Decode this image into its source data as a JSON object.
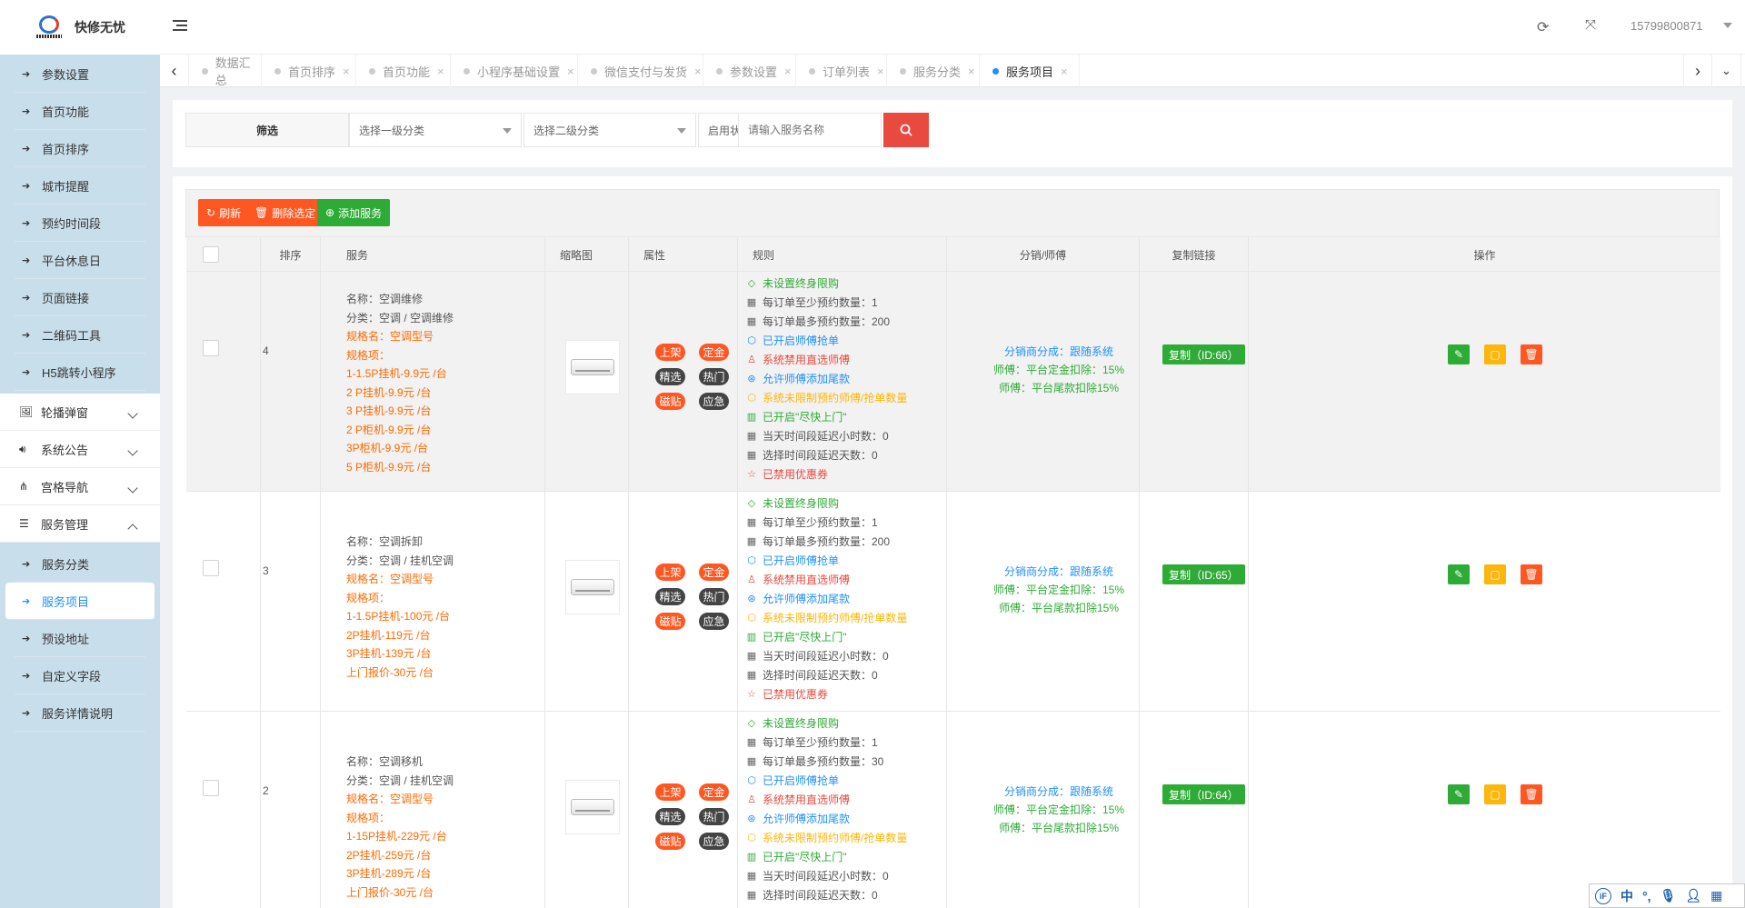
{
  "app": {
    "name": "快修无忧"
  },
  "sidebar": {
    "items": [
      {
        "label": "参数设置"
      },
      {
        "label": "首页功能"
      },
      {
        "label": "首页排序"
      },
      {
        "label": "城市提醒"
      },
      {
        "label": "预约时间段"
      },
      {
        "label": "平台休息日"
      },
      {
        "label": "页面链接"
      },
      {
        "label": "二维码工具"
      },
      {
        "label": "H5跳转小程序"
      }
    ],
    "groups": [
      {
        "label": "轮播弹窗",
        "icon": "image-icon"
      },
      {
        "label": "系统公告",
        "icon": "speaker-icon"
      },
      {
        "label": "宫格导航",
        "icon": "sitemap-icon"
      },
      {
        "label": "服务管理",
        "icon": "server-icon"
      }
    ],
    "sub_items": [
      {
        "label": "服务分类"
      },
      {
        "label": "服务项目"
      },
      {
        "label": "预设地址"
      },
      {
        "label": "自定义字段"
      },
      {
        "label": "服务详情说明"
      }
    ]
  },
  "topbar": {
    "user": "15799800871"
  },
  "tabs": [
    {
      "label": "数据汇总"
    },
    {
      "label": "首页排序"
    },
    {
      "label": "首页功能"
    },
    {
      "label": "小程序基础设置"
    },
    {
      "label": "微信支付与发货"
    },
    {
      "label": "参数设置"
    },
    {
      "label": "订单列表"
    },
    {
      "label": "服务分类"
    },
    {
      "label": "服务项目"
    }
  ],
  "filter": {
    "label": "筛选",
    "select1": "选择一级分类",
    "select2": "选择二级分类",
    "select3": "启用状态",
    "search_placeholder": "请输入服务名称"
  },
  "actions": {
    "refresh": "刷新",
    "delete_selected": "删除选定",
    "add_service": "添加服务"
  },
  "columns": [
    "排序",
    "服务",
    "缩略图",
    "属性",
    "规则",
    "分销/师傅",
    "复制链接",
    "操作"
  ],
  "colors": {
    "orange": "#ff5722",
    "green": "#2eab36",
    "blue": "#1e90ff",
    "red": "#e84a3f",
    "yellow": "#fdb60b"
  },
  "rows": [
    {
      "sort": "4",
      "name": "名称：空调维修",
      "category": "分类：空调 / 空调维修",
      "spec_name": "规格名：空调型号",
      "spec_title": "规格项：",
      "specs": [
        "1-1.5P挂机-9.9元 /台",
        "2 P挂机-9.9元 /台",
        " 3 P挂机-9.9元 /台",
        "2 P柜机-9.9元 /台",
        "3P柜机-9.9元 /台",
        " 5 P柜机-9.9元 /台"
      ],
      "tags": [
        "上架",
        "定金",
        "精选",
        "热门",
        "磁贴",
        "应急"
      ],
      "rules": [
        "未设置终身限购",
        "每订单至少预约数量：1",
        "每订单最多预约数量：200",
        "已开启师傅抢单",
        "系统禁用直选师傅",
        "允许师傅添加尾款",
        "系统未限制预约师傅/抢单数量",
        "已开启\"尽快上门\"",
        "当天时间段延迟小时数：0",
        "选择时间段延迟天数：0",
        "已禁用优惠券"
      ],
      "dist": [
        "分销商分成：跟随系统",
        "师傅：平台定金扣除：15%",
        "师傅：平台尾款扣除15%"
      ],
      "copy": "复制（ID:66）"
    },
    {
      "sort": "3",
      "name": "名称：空调拆卸",
      "category": "分类：空调 / 挂机空调",
      "spec_name": "规格名：空调型号",
      "spec_title": "规格项：",
      "specs": [
        "1-1.5P挂机-100元 /台",
        "2P挂机-119元 /台",
        "3P挂机-139元 /台",
        "上门报价-30元 /台"
      ],
      "tags": [
        "上架",
        "定金",
        "精选",
        "热门",
        "磁贴",
        "应急"
      ],
      "rules": [
        "未设置终身限购",
        "每订单至少预约数量：1",
        "每订单最多预约数量：200",
        "已开启师傅抢单",
        "系统禁用直选师傅",
        "允许师傅添加尾款",
        "系统未限制预约师傅/抢单数量",
        "已开启\"尽快上门\"",
        "当天时间段延迟小时数：0",
        "选择时间段延迟天数：0",
        "已禁用优惠券"
      ],
      "dist": [
        "分销商分成：跟随系统",
        "师傅：平台定金扣除：15%",
        "师傅：平台尾款扣除15%"
      ],
      "copy": "复制（ID:65）"
    },
    {
      "sort": "2",
      "name": "名称：空调移机",
      "category": "分类：空调 / 挂机空调",
      "spec_name": "规格名：空调型号",
      "spec_title": "规格项：",
      "specs": [
        "1-15P挂机-229元 /台",
        "2P挂机-259元 /台",
        "3P挂机-289元 /台",
        "上门报价-30元 /台"
      ],
      "tags": [
        "上架",
        "定金",
        "精选",
        "热门",
        "磁贴",
        "应急"
      ],
      "rules": [
        "未设置终身限购",
        "每订单至少预约数量：1",
        "每订单最多预约数量：30",
        "已开启师傅抢单",
        "系统禁用直选师傅",
        "允许师傅添加尾款",
        "系统未限制预约师傅/抢单数量",
        "已开启\"尽快上门\"",
        "当天时间段延迟小时数：0",
        "选择时间段延迟天数：0"
      ],
      "dist": [
        "分销商分成：跟随系统",
        "师傅：平台定金扣除：15%",
        "师傅：平台尾款扣除15%"
      ],
      "copy": "复制（ID:64）"
    }
  ],
  "ime": {
    "lang": "中"
  }
}
